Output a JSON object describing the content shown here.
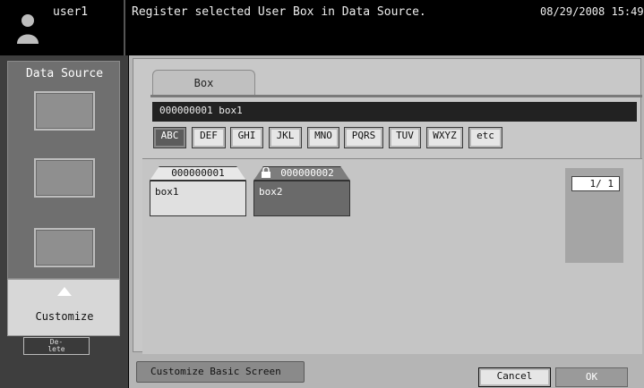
{
  "header": {
    "user": "user1",
    "message": "Register selected User Box in Data Source.",
    "datetime": "08/29/2008 15:49"
  },
  "left_panel": {
    "title": "Data Source",
    "customize_label": "Customize",
    "delete_label_line1": "De-",
    "delete_label_line2": "lete"
  },
  "main": {
    "tab_label": "Box",
    "path_text": "000000001   box1",
    "alpha_buttons": [
      {
        "label": "ABC",
        "selected": true
      },
      {
        "label": "DEF",
        "selected": false
      },
      {
        "label": "GHI",
        "selected": false
      },
      {
        "label": "JKL",
        "selected": false
      },
      {
        "label": "MNO",
        "selected": false
      },
      {
        "label": "PQRS",
        "selected": false
      },
      {
        "label": "TUV",
        "selected": false
      },
      {
        "label": "WXYZ",
        "selected": false
      },
      {
        "label": "etc",
        "selected": false
      }
    ],
    "boxes": [
      {
        "number": "000000001",
        "name": "box1",
        "locked": false
      },
      {
        "number": "000000002",
        "name": "box2",
        "locked": true
      }
    ],
    "pager": {
      "text": "1/  1"
    }
  },
  "bottom": {
    "customize_basic_label": "Customize Basic Screen",
    "cancel_label": "Cancel",
    "ok_label": "OK"
  }
}
